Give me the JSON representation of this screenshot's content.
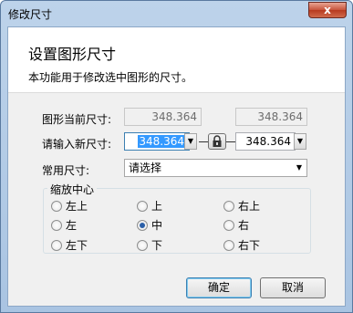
{
  "window": {
    "title": "修改尺寸",
    "close_glyph": "x"
  },
  "header": {
    "title": "设置图形尺寸",
    "description": "本功能用于修改选中图形的尺寸。"
  },
  "current_size": {
    "label": "图形当前尺寸:",
    "width": "348.364",
    "height": "348.364"
  },
  "new_size": {
    "label": "请输入新尺寸:",
    "width": "348.364",
    "height": "348.364",
    "lock_icon": "lock-icon"
  },
  "common_size": {
    "label": "常用尺寸:",
    "selected": "请选择"
  },
  "anchor": {
    "legend": "缩放中心",
    "options": [
      "左上",
      "上",
      "右上",
      "左",
      "中",
      "右",
      "左下",
      "下",
      "右下"
    ],
    "selected": "中"
  },
  "buttons": {
    "ok": "确定",
    "cancel": "取消"
  }
}
